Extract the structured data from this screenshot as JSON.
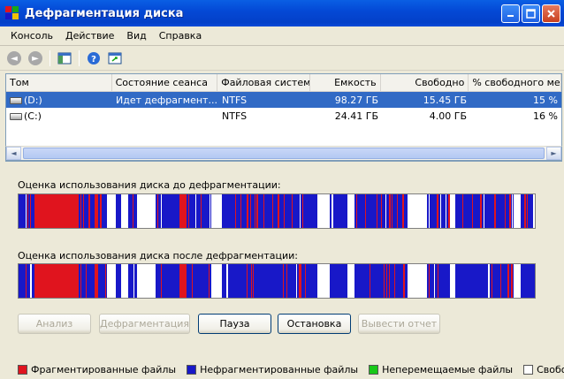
{
  "window": {
    "title": "Дефрагментация диска"
  },
  "menu": [
    "Консоль",
    "Действие",
    "Вид",
    "Справка"
  ],
  "toolbar": {
    "icons": [
      "back-icon",
      "forward-icon",
      "show-hide-tree-icon",
      "help-icon",
      "export-icon"
    ]
  },
  "volumes": {
    "columns": [
      "Том",
      "Состояние сеанса",
      "Файловая система",
      "Емкость",
      "Свободно",
      "% свободного мест"
    ],
    "rows": [
      {
        "volume": "(D:)",
        "status": "Идет дефрагмент...",
        "fs": "NTFS",
        "capacity": "98.27 ГБ",
        "free": "15.45 ГБ",
        "pct": "15 %"
      },
      {
        "volume": "(C:)",
        "status": "",
        "fs": "NTFS",
        "capacity": "24.41 ГБ",
        "free": "4.00 ГБ",
        "pct": "16 %"
      }
    ]
  },
  "analysis": {
    "before_label": "Оценка использования диска до дефрагментации:",
    "after_label": "Оценка использования диска после дефрагментации:"
  },
  "buttons": {
    "analyze": "Анализ",
    "defrag": "Дефрагментация",
    "pause": "Пауза",
    "stop": "Остановка",
    "report": "Вывести отчет"
  },
  "legend": {
    "fragmented": "Фрагментированные файлы",
    "contiguous": "Нефрагментированные файлы",
    "unmovable": "Неперемещаемые файлы",
    "free": "Свободно"
  },
  "colors": {
    "fragmented": "#e0141e",
    "contiguous": "#1818c8",
    "unmovable": "#18c818",
    "free": "#ffffff",
    "selection": "#316ac5"
  }
}
